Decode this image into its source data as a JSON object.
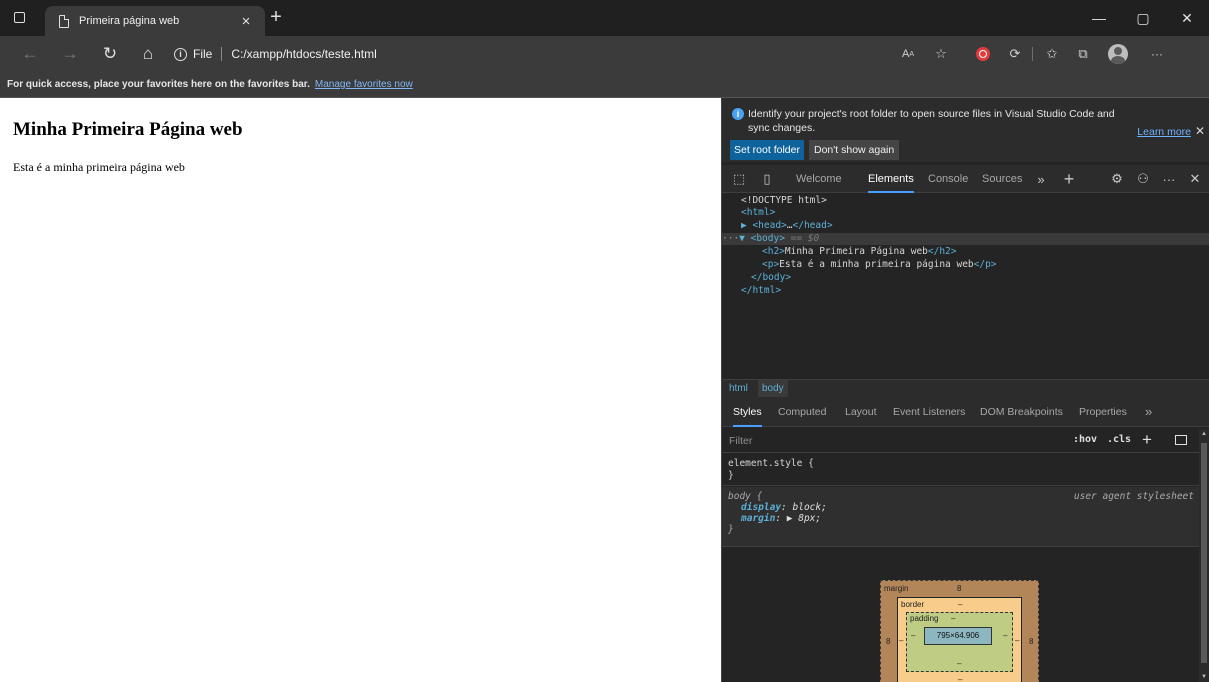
{
  "window": {
    "tab_title": "Primeira página web",
    "tab_close": "×",
    "new_tab": "+",
    "minimize": "—",
    "restore": "▢",
    "close": "✕"
  },
  "address_bar": {
    "site_label": "File",
    "url": "C:/xampp/htdocs/teste.html"
  },
  "favorites_bar": {
    "text": "For quick access, place your favorites here on the favorites bar.",
    "link": "Manage favorites now"
  },
  "page": {
    "heading": "Minha Primeira Página web",
    "paragraph": "Esta é a minha primeira página web"
  },
  "devtools": {
    "infobar": {
      "message": "Identify your project's root folder to open source files in Visual Studio Code and sync changes.",
      "learn_more": "Learn more",
      "close": "✕",
      "set_root": "Set root folder",
      "dont_show": "Don't show again"
    },
    "tabs": [
      "Welcome",
      "Elements",
      "Console",
      "Sources"
    ],
    "more_tabs": "»",
    "add_tab": "+",
    "more": "···",
    "close": "✕",
    "dom": {
      "l1": "<!DOCTYPE html>",
      "l2": "<html>",
      "l3_open": "▶ <head>",
      "l3_ellipsis": "…",
      "l3_close": "</head>",
      "l4_dots": "···",
      "l4": "▼ <body>",
      "l4_hint": " == $0",
      "l5_open": "<h2>",
      "l5_text": "Minha Primeira Página web",
      "l5_close": "</h2>",
      "l6_open": "<p>",
      "l6_text": "Esta é a minha primeira página web",
      "l6_close": "</p>",
      "l7": "</body>",
      "l8": "</html>"
    },
    "breadcrumbs": [
      "html",
      "body"
    ],
    "sub_tabs": [
      "Styles",
      "Computed",
      "Layout",
      "Event Listeners",
      "DOM Breakpoints",
      "Properties"
    ],
    "sub_more": "»",
    "filter_placeholder": "Filter",
    "hov": ":hov",
    "cls": ".cls",
    "plus": "+",
    "rules": {
      "r1_selector": "element.style {",
      "r1_close": "}",
      "r2_selector": "body {",
      "r2_source": "user agent stylesheet",
      "r2_p1_name": "display",
      "r2_p1_value": "block;",
      "r2_p2_name": "margin",
      "r2_p2_value": "▶ 8px;",
      "r2_close": "}"
    },
    "box_model": {
      "margin_label": "margin",
      "margin_top": "8",
      "margin_left": "8",
      "margin_right": "8",
      "border_label": "border",
      "border_top": "–",
      "border_left": "–",
      "border_right": "–",
      "padding_label": "padding",
      "padding_top": "–",
      "padding_left": "–",
      "padding_right": "–",
      "padding_bottom": "–",
      "border_bottom": "–",
      "content": "795×64.906"
    }
  },
  "colors": {
    "accent": "#4a9eff",
    "primary_button": "#0e639c",
    "tag": "#5db0d7"
  }
}
